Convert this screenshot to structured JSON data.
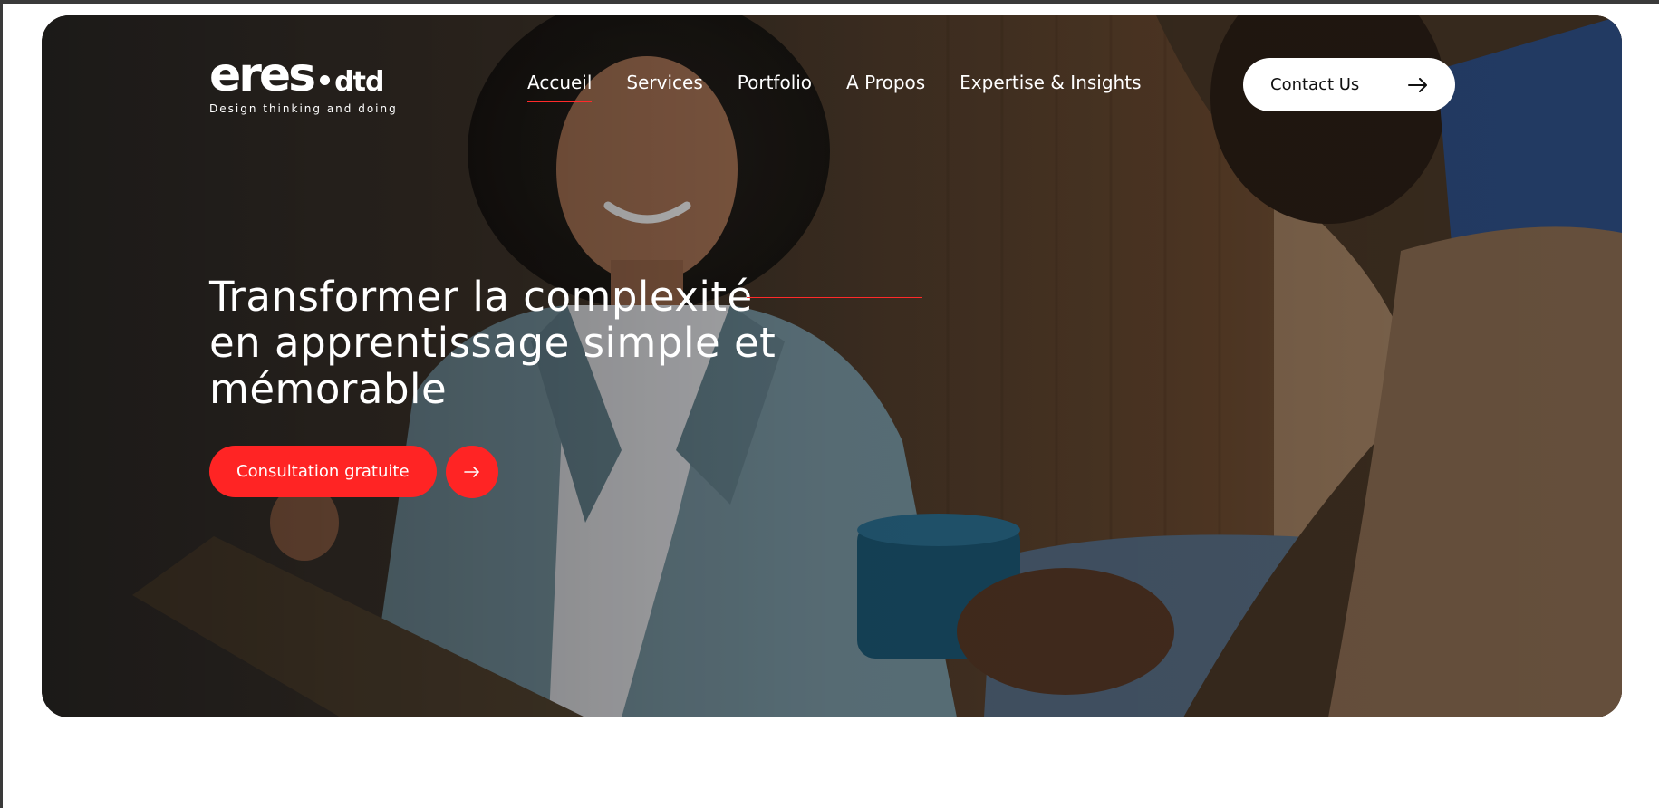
{
  "logo": {
    "main": "eres",
    "suffix": "dtd",
    "tagline": "Design thinking and doing"
  },
  "nav": {
    "items": [
      {
        "label": "Accueil",
        "active": true
      },
      {
        "label": "Services",
        "active": false
      },
      {
        "label": "Portfolio",
        "active": false
      },
      {
        "label": "A Propos",
        "active": false
      },
      {
        "label": "Expertise & Insights",
        "active": false
      }
    ]
  },
  "header": {
    "contact_label": "Contact Us",
    "contact_icon": "arrow-right-icon"
  },
  "hero": {
    "headline": "Transformer la complexité en apprentissage simple et mémorable",
    "cta_label": "Consultation gratuite",
    "cta_icon": "arrow-right-icon",
    "background_image": "photo of a smiling woman in a grey-blue blazer holding a clipboard, talking with a man holding a blue mug"
  },
  "colors": {
    "accent": "#ff2424",
    "text_on_hero": "#ffffff",
    "contact_button_bg": "#ffffff"
  }
}
